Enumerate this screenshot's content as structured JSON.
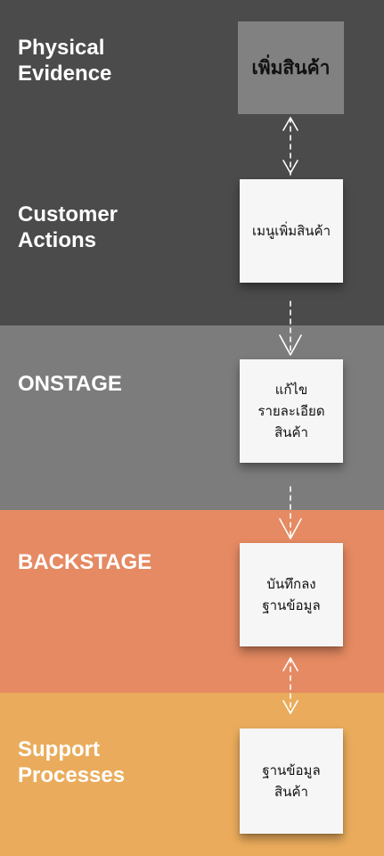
{
  "lanes": [
    {
      "label": "Physical\nEvidence",
      "color": "#4b4b4b"
    },
    {
      "label": "Customer\nActions",
      "color": "#4b4b4b"
    },
    {
      "label": "ONSTAGE",
      "color": "#7c7c7c"
    },
    {
      "label": "BACKSTAGE",
      "color": "#e58a62"
    },
    {
      "label": "Support\nProcesses",
      "color": "#eaac5c"
    }
  ],
  "boxes": {
    "evidence": {
      "text": "เพิ่มสินค้า",
      "color": "#818181"
    },
    "customer": {
      "text": "เมนูเพิ่มสินค้า"
    },
    "onstage": {
      "text": "แก้ไข\nรายละเอียด\nสินค้า"
    },
    "backstage": {
      "text": "บันทึกลง\nฐานข้อมูล"
    },
    "support": {
      "text": "ฐานข้อมูล\nสินค้า"
    }
  },
  "connectors": [
    {
      "from": "evidence",
      "to": "customer",
      "style": "bidirectional"
    },
    {
      "from": "customer",
      "to": "onstage",
      "style": "one-way"
    },
    {
      "from": "onstage",
      "to": "backstage",
      "style": "one-way"
    },
    {
      "from": "backstage",
      "to": "support",
      "style": "bidirectional"
    }
  ],
  "colors": {
    "note_paper": "#f6f6f6",
    "connector": "#ffffff",
    "dark_lane": "#4b4b4b"
  }
}
